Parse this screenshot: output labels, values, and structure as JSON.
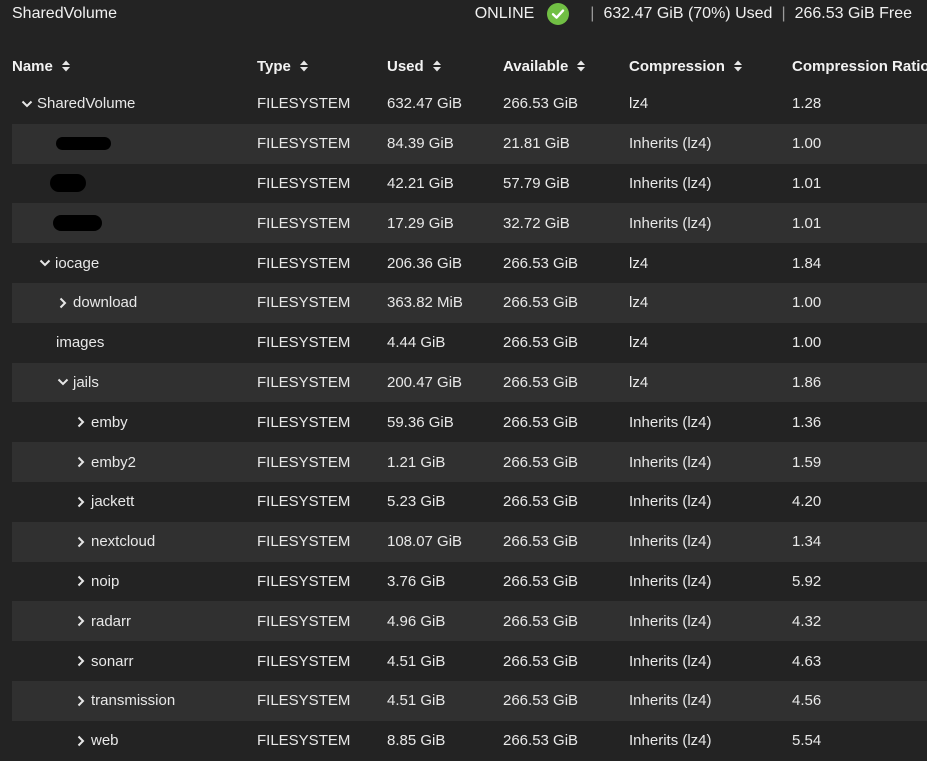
{
  "header": {
    "pool_name": "SharedVolume",
    "status": "ONLINE",
    "used": "632.47 GiB (70%) Used",
    "free": "266.53 GiB Free",
    "status_color": "#71bf44"
  },
  "columns": [
    "Name",
    "Type",
    "Used",
    "Available",
    "Compression",
    "Compression Ratio"
  ],
  "rows": [
    {
      "name": "SharedVolume",
      "type": "FILESYSTEM",
      "used": "632.47 GiB",
      "available": "266.53 GiB",
      "compression": "lz4",
      "ratio": "1.28",
      "expander": "chevron-down-icon"
    },
    {
      "name": "",
      "type": "FILESYSTEM",
      "used": "84.39 GiB",
      "available": "21.81 GiB",
      "compression": "Inherits (lz4)",
      "ratio": "1.00",
      "redacted": true
    },
    {
      "name": "",
      "type": "FILESYSTEM",
      "used": "42.21 GiB",
      "available": "57.79 GiB",
      "compression": "Inherits (lz4)",
      "ratio": "1.01",
      "redacted": true
    },
    {
      "name": "",
      "type": "FILESYSTEM",
      "used": "17.29 GiB",
      "available": "32.72 GiB",
      "compression": "Inherits (lz4)",
      "ratio": "1.01",
      "redacted": true
    },
    {
      "name": "iocage",
      "type": "FILESYSTEM",
      "used": "206.36 GiB",
      "available": "266.53 GiB",
      "compression": "lz4",
      "ratio": "1.84",
      "expander": "chevron-down-icon"
    },
    {
      "name": "download",
      "type": "FILESYSTEM",
      "used": "363.82 MiB",
      "available": "266.53 GiB",
      "compression": "lz4",
      "ratio": "1.00",
      "expander": "chevron-right-icon"
    },
    {
      "name": "images",
      "type": "FILESYSTEM",
      "used": "4.44 GiB",
      "available": "266.53 GiB",
      "compression": "lz4",
      "ratio": "1.00"
    },
    {
      "name": "jails",
      "type": "FILESYSTEM",
      "used": "200.47 GiB",
      "available": "266.53 GiB",
      "compression": "lz4",
      "ratio": "1.86",
      "expander": "chevron-down-icon"
    },
    {
      "name": "emby",
      "type": "FILESYSTEM",
      "used": "59.36 GiB",
      "available": "266.53 GiB",
      "compression": "Inherits (lz4)",
      "ratio": "1.36",
      "expander": "chevron-right-icon"
    },
    {
      "name": "emby2",
      "type": "FILESYSTEM",
      "used": "1.21 GiB",
      "available": "266.53 GiB",
      "compression": "Inherits (lz4)",
      "ratio": "1.59",
      "expander": "chevron-right-icon"
    },
    {
      "name": "jackett",
      "type": "FILESYSTEM",
      "used": "5.23 GiB",
      "available": "266.53 GiB",
      "compression": "Inherits (lz4)",
      "ratio": "4.20",
      "expander": "chevron-right-icon"
    },
    {
      "name": "nextcloud",
      "type": "FILESYSTEM",
      "used": "108.07 GiB",
      "available": "266.53 GiB",
      "compression": "Inherits (lz4)",
      "ratio": "1.34",
      "expander": "chevron-right-icon"
    },
    {
      "name": "noip",
      "type": "FILESYSTEM",
      "used": "3.76 GiB",
      "available": "266.53 GiB",
      "compression": "Inherits (lz4)",
      "ratio": "5.92",
      "expander": "chevron-right-icon"
    },
    {
      "name": "radarr",
      "type": "FILESYSTEM",
      "used": "4.96 GiB",
      "available": "266.53 GiB",
      "compression": "Inherits (lz4)",
      "ratio": "4.32",
      "expander": "chevron-right-icon"
    },
    {
      "name": "sonarr",
      "type": "FILESYSTEM",
      "used": "4.51 GiB",
      "available": "266.53 GiB",
      "compression": "Inherits (lz4)",
      "ratio": "4.63",
      "expander": "chevron-right-icon"
    },
    {
      "name": "transmission",
      "type": "FILESYSTEM",
      "used": "4.51 GiB",
      "available": "266.53 GiB",
      "compression": "Inherits (lz4)",
      "ratio": "4.56",
      "expander": "chevron-right-icon"
    },
    {
      "name": "web",
      "type": "FILESYSTEM",
      "used": "8.85 GiB",
      "available": "266.53 GiB",
      "compression": "Inherits (lz4)",
      "ratio": "5.54",
      "expander": "chevron-right-icon"
    }
  ]
}
